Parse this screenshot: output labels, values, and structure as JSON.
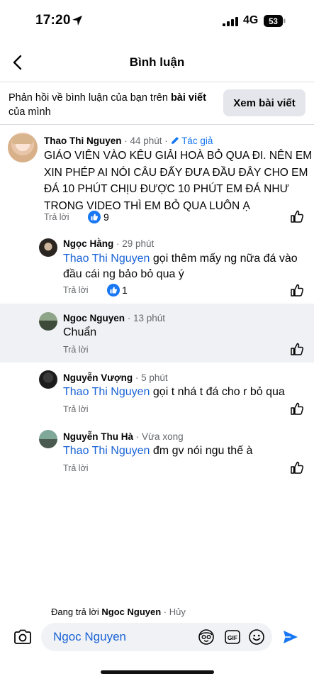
{
  "status_bar": {
    "time": "17:20",
    "network": "4G",
    "battery": "53"
  },
  "nav": {
    "title": "Bình luận"
  },
  "banner": {
    "text_before": "Phản hồi về bình luận của bạn trên ",
    "text_bold": "bài viết",
    "text_after": " của mình",
    "button_label": "Xem bài viết"
  },
  "comments": [
    {
      "author": "Thao Thi Nguyen",
      "time": "44 phút",
      "badge": "Tác giả",
      "lines": [
        "GIÁO VIÊN VÀO KÊU GIẢI HOÀ BỎ QUA ĐI. NÊN EM",
        "XIN PHÉP AI NÓI CÂU ĐẤY ĐƯA ĐẦU ĐÂY CHO EM",
        "ĐÁ 10 PHÚT CHỊU ĐƯỢC 10 PHÚT EM ĐÁ NHƯ",
        "TRONG VIDEO THÌ EM BỎ QUA LUÔN Ạ"
      ],
      "reply_label": "Trả lời",
      "reactions": "9"
    },
    {
      "author": "Ngọc Hằng",
      "time": "29 phút",
      "mention": "Thao Thi Nguyen",
      "line1_rest": " gọi thêm mấy ng nữa đá vào",
      "line2": "đầu cái ng bảo bỏ qua ý",
      "reply_label": "Trả lời",
      "reactions": "1"
    },
    {
      "author": "Ngoc Nguyen",
      "time": "13 phút",
      "text": "Chuẩn",
      "reply_label": "Trả lời"
    },
    {
      "author": "Nguyễn Vượng",
      "time": "5 phút",
      "mention": "Thao Thi Nguyen",
      "rest": " gọi t nhá t đá cho r bỏ qua",
      "reply_label": "Trả lời"
    },
    {
      "author": "Nguyễn Thu Hà",
      "time": "Vừa xong",
      "mention": "Thao Thi Nguyen",
      "rest": " đm gv nói ngu thế à",
      "reply_label": "Trả lời"
    }
  ],
  "composer": {
    "replying_prefix": "Đang trả lời ",
    "replying_to": "Ngoc Nguyen",
    "cancel_label": "Hủy",
    "input_value": "Ngoc Nguyen",
    "gif_label": "GIF"
  },
  "colors": {
    "mention": "#1a63d6",
    "like": "#1877f2",
    "highlight": "#eff1f5"
  }
}
